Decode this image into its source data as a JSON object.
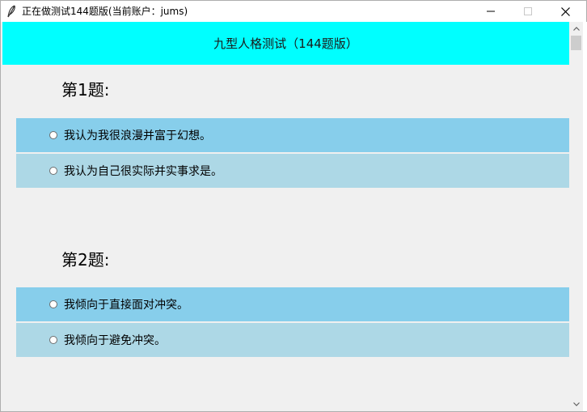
{
  "window": {
    "title": "正在做测试144题版(当前账户：jums)",
    "icons": {
      "app": "feather-icon",
      "minimize": "minimize-icon",
      "maximize": "maximize-icon",
      "close": "close-icon"
    }
  },
  "banner": {
    "title": "九型人格测试（144题版）",
    "background": "#00ffff"
  },
  "questions": [
    {
      "title": "第1题:",
      "options": [
        {
          "label": "我认为我很浪漫并富于幻想。",
          "color": "#87ceeb"
        },
        {
          "label": "我认为自己很实际并实事求是。",
          "color": "#add8e6"
        }
      ]
    },
    {
      "title": "第2题:",
      "options": [
        {
          "label": "我倾向于直接面对冲突。",
          "color": "#87ceeb"
        },
        {
          "label": "我倾向于避免冲突。",
          "color": "#add8e6"
        }
      ]
    }
  ],
  "scrollbar": {
    "up_icon": "arrow-up-icon",
    "down_icon": "arrow-down-icon"
  }
}
